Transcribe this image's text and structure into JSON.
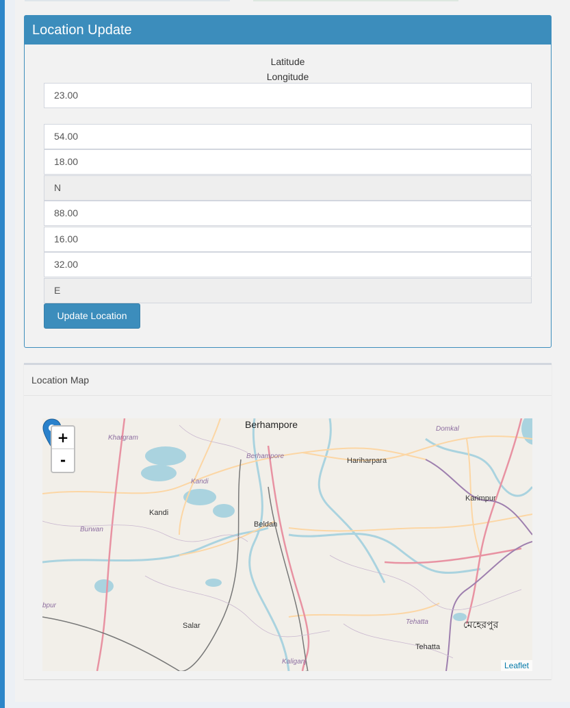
{
  "update_panel": {
    "title": "Location Update",
    "latitude_label": "Latitude",
    "longitude_label": "Longitude",
    "fields": {
      "lat_deg": "23.00",
      "lat_min": "54.00",
      "lat_sec": "18.00",
      "lat_dir": "N",
      "lon_deg": "88.00",
      "lon_min": "16.00",
      "lon_sec": "32.00",
      "lon_dir": "E"
    },
    "button_label": "Update Location"
  },
  "map_panel": {
    "title": "Location Map",
    "zoom_in": "+",
    "zoom_out": "-",
    "attribution": "Leaflet",
    "places": {
      "berhampore_big": "Berhampore",
      "khargram": "Khargram",
      "berhampore_small": "Berhampore",
      "domkal": "Domkal",
      "hariharpara": "Hariharpara",
      "kandi_italic": "Kandi",
      "kandi": "Kandi",
      "karimpur": "Karimpur",
      "burwan": "Burwan",
      "beldanga": "Beldan",
      "bpur": "bpur",
      "salar": "Salar",
      "tehatta_italic": "Tehatta",
      "meherpur": "মেহেরপুর",
      "tehatta": "Tehatta",
      "kaliganj": "Kaliganj"
    },
    "colors": {
      "major_road": "#e892a2",
      "secondary_road": "#fcd6a4",
      "river": "#aad3df",
      "boundary": "#9e7fae"
    }
  }
}
